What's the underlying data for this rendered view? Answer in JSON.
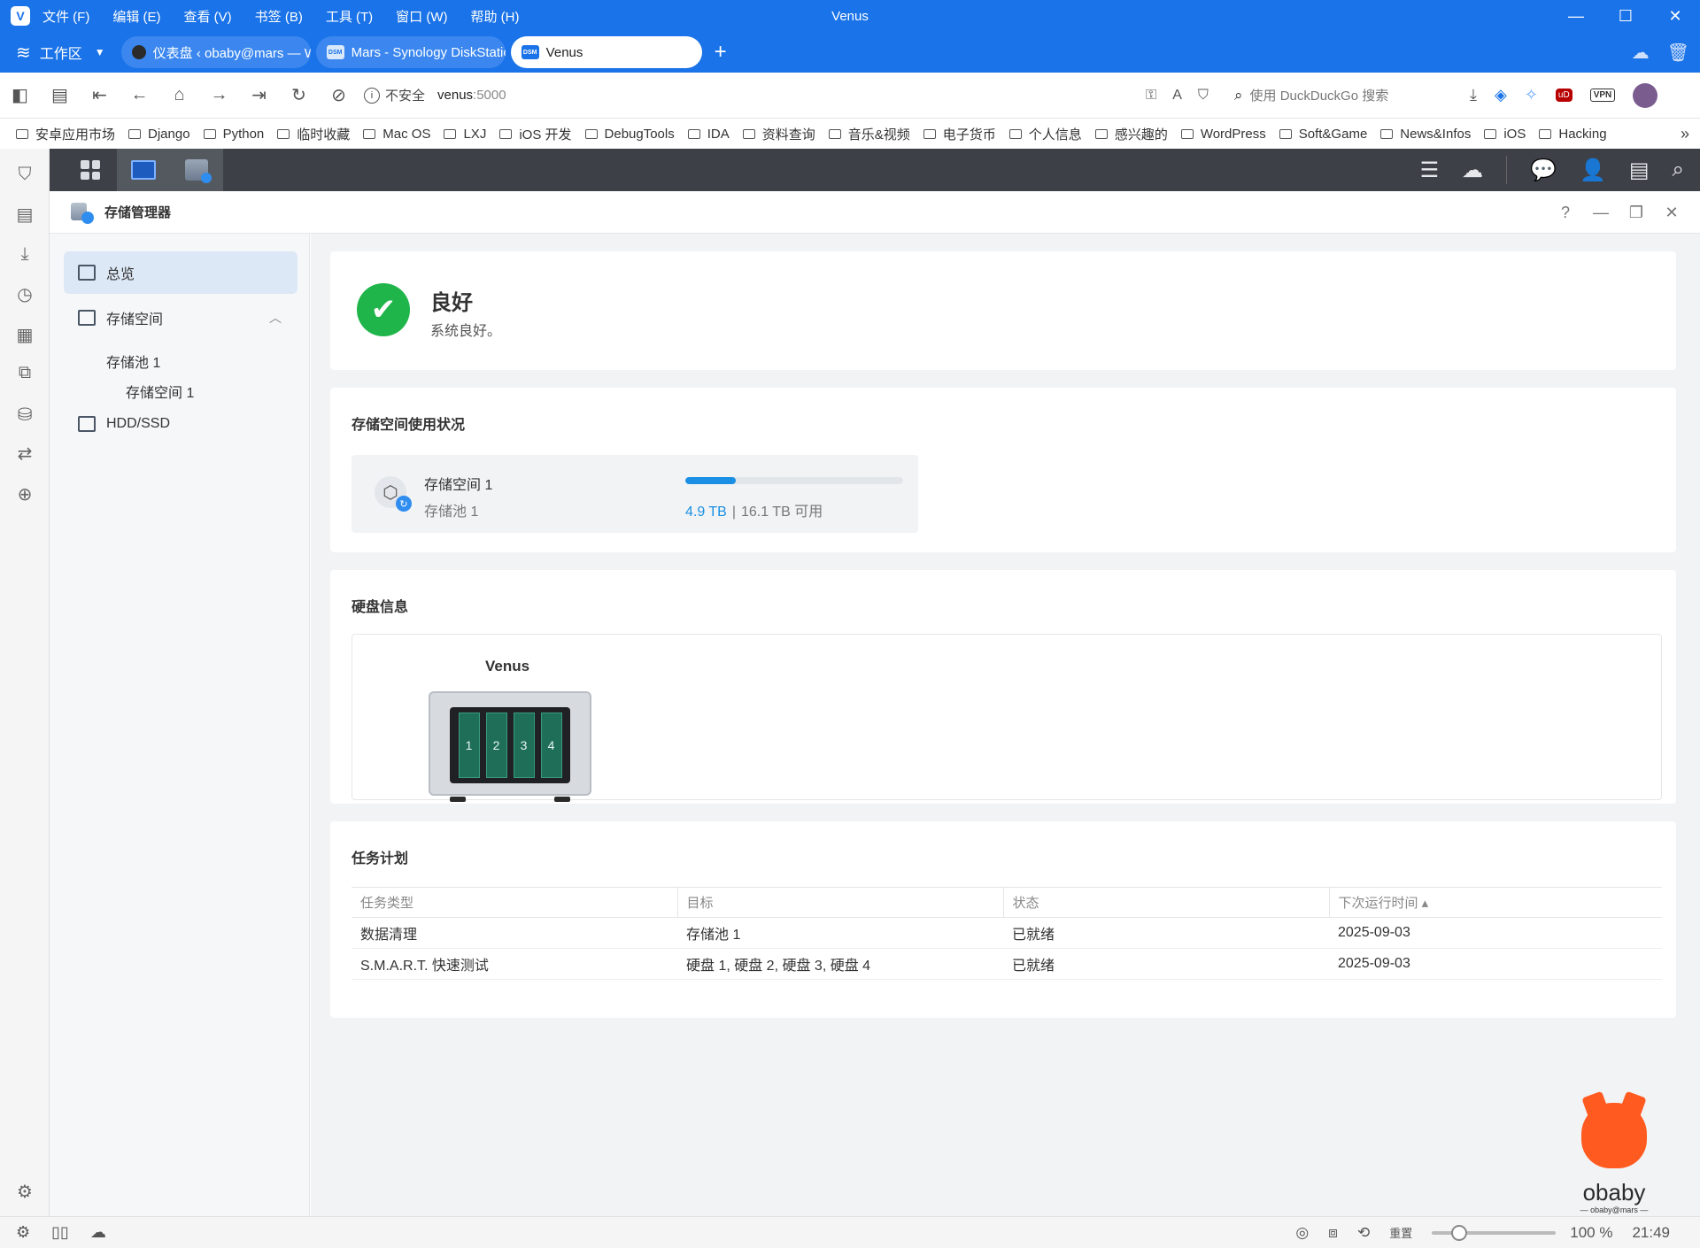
{
  "browser": {
    "window_title": "Venus",
    "menus": [
      "文件 (F)",
      "编辑 (E)",
      "查看 (V)",
      "书签 (B)",
      "工具 (T)",
      "窗口 (W)",
      "帮助 (H)"
    ],
    "workspace_label": "工作区",
    "tabs": [
      {
        "label": "仪表盘 ‹ obaby@mars — W",
        "active": false
      },
      {
        "label": "Mars - Synology DiskStation",
        "active": false
      },
      {
        "label": "Venus",
        "active": true
      }
    ],
    "dsm_badge": "DSM",
    "address": {
      "security": "不安全",
      "host": "venus",
      "port": ":5000"
    },
    "search_placeholder": "使用 DuckDuckGo 搜索",
    "ublock_label": "uD",
    "vpn_label": "VPN",
    "bookmarks": [
      "安卓应用市场",
      "Django",
      "Python",
      "临时收藏",
      "Mac OS",
      "LXJ",
      "iOS 开发",
      "DebugTools",
      "IDA",
      "资料查询",
      "音乐&视频",
      "电子货币",
      "个人信息",
      "感兴趣的",
      "WordPress",
      "Soft&Game",
      "News&Infos",
      "iOS",
      "Hacking"
    ]
  },
  "app": {
    "title": "存储管理器",
    "sidebar": {
      "overview": "总览",
      "storage": "存储空间",
      "pool": "存储池 1",
      "volume": "存储空间 1",
      "hdd": "HDD/SSD"
    },
    "status": {
      "title": "良好",
      "desc": "系统良好。"
    },
    "usage": {
      "title": "存储空间使用状况",
      "volume_name": "存储空间 1",
      "pool_name": "存储池 1",
      "used": "4.9 TB",
      "separator": "|",
      "available": "16.1 TB 可用",
      "used_fraction": 0.233
    },
    "disk": {
      "title": "硬盘信息",
      "nas_name": "Venus",
      "bays": [
        "1",
        "2",
        "3",
        "4"
      ]
    },
    "tasks": {
      "title": "任务计划",
      "columns": [
        "任务类型",
        "目标",
        "状态",
        "下次运行时间 ▴"
      ],
      "rows": [
        [
          "数据清理",
          "存储池 1",
          "已就绪",
          "2025-09-03"
        ],
        [
          "S.M.A.R.T. 快速测试",
          "硬盘 1, 硬盘 2, 硬盘 3, 硬盘 4",
          "已就绪",
          "2025-09-03"
        ]
      ]
    }
  },
  "statusbar": {
    "reset_label": "重置",
    "zoom": "100 %",
    "time": "21:49"
  },
  "watermark": {
    "name": "obaby",
    "sub": "— obaby@mars —"
  },
  "colors": {
    "accent": "#1a73e8",
    "ok": "#1fb54a",
    "usage_fill": "#1a8fe3"
  }
}
